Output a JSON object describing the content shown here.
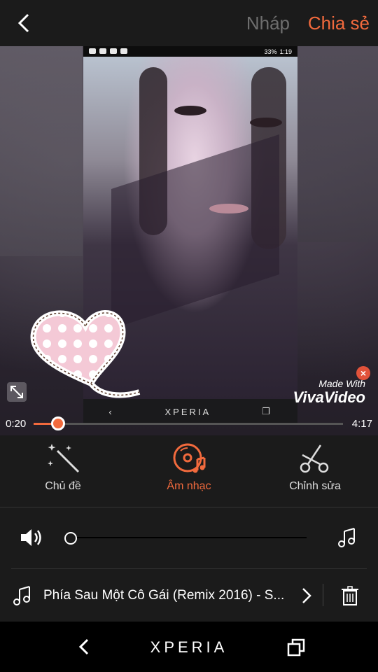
{
  "header": {
    "draft_label": "Nháp",
    "share_label": "Chia sẻ"
  },
  "preview": {
    "phone_status_time": "1:19",
    "phone_status_battery": "33%",
    "phone_nav_brand": "XPERIA",
    "watermark_top": "Made With",
    "watermark_main": "VivaVideo"
  },
  "timeline": {
    "current": "0:20",
    "total": "4:17",
    "progress": 0.08
  },
  "tabs": [
    {
      "label": "Chủ đề",
      "icon": "magic-wand-icon"
    },
    {
      "label": "Âm nhạc",
      "icon": "music-disc-icon",
      "active": true
    },
    {
      "label": "Chỉnh sửa",
      "icon": "scissors-icon"
    }
  ],
  "volume": {
    "level": 0.0
  },
  "song": {
    "title": "Phía Sau Một Cô Gái (Remix 2016) - S..."
  },
  "system_nav": {
    "brand": "XPERIA"
  },
  "colors": {
    "accent": "#f26a3d",
    "background": "#1b1b1b"
  }
}
